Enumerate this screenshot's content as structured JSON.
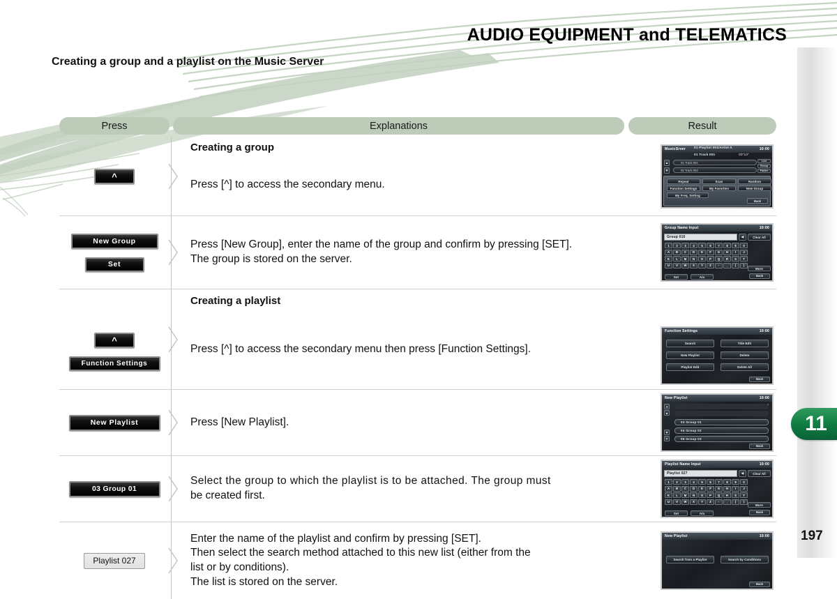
{
  "header": {
    "title": "AUDIO EQUIPMENT and TELEMATICS"
  },
  "subtitle": "Creating a group and a playlist on the Music Server",
  "columns": {
    "press": "Press",
    "explanations": "Explanations",
    "result": "Result"
  },
  "sections": {
    "group": "Creating a group",
    "playlist": "Creating a playlist"
  },
  "chapter_tab": "11",
  "page_number": "197",
  "rows": [
    {
      "keys": [
        {
          "label": "^",
          "style": "kup"
        }
      ],
      "explanation": [
        "Press [^] to access the secondary menu."
      ]
    },
    {
      "keys": [
        {
          "label": "New Group",
          "style": "wide"
        },
        {
          "label": "Set",
          "style": "set"
        }
      ],
      "explanation": [
        "Press [New Group], enter the name of the group and confirm by pressing [SET].",
        "The group is stored on the server."
      ]
    },
    {
      "keys": [
        {
          "label": "^",
          "style": "kup"
        },
        {
          "label": "Function Settings",
          "style": "fn"
        }
      ],
      "explanation": [
        "Press [^] to access the secondary menu then press [Function Settings]."
      ]
    },
    {
      "keys": [
        {
          "label": "New Playlist",
          "style": "newpl"
        }
      ],
      "explanation": [
        "Press [New Playlist]."
      ]
    },
    {
      "keys": [
        {
          "label": "03   Group 01",
          "style": "grp"
        }
      ],
      "explanation": [
        "Select the group to which the playlist is to be attached. The group must",
        "be created first."
      ]
    },
    {
      "keys": [
        {
          "label": "Playlist 027",
          "style": "light"
        }
      ],
      "explanation": [
        "Enter the name of the playlist and confirm by pressing [SET].",
        "Then select the search method attached to this new list (either from the",
        "list or by conditions).",
        "The list is stored on the server."
      ]
    }
  ],
  "screens": {
    "music_server": {
      "title": "MusicSrver",
      "clock": "10:00",
      "meta_line1": "01 Playlist 001/Artist A",
      "meta_line2": "01 Track 001",
      "time_elapsed": "00\"13\"",
      "track_row": "01  Track 001",
      "track_row2": "02  Track 002",
      "side_buttons": [
        "List",
        "Group",
        "Folder"
      ],
      "buttons": [
        "Repeat",
        "Scan",
        "Random",
        "Function Settings",
        "My Favorites",
        "New Group",
        "My Freq. Setting"
      ],
      "back": "Back"
    },
    "group_name_input": {
      "title": "Group Name Input",
      "clock": "10:00",
      "field_value": "Group 010",
      "clear_all": "Clear All",
      "more": "More",
      "set": "Set",
      "case": "A/a",
      "back": "Back",
      "keyrows": [
        [
          "1",
          "2",
          "3",
          "4",
          "5",
          "6",
          "7",
          "8",
          "9",
          "0"
        ],
        [
          "A",
          "B",
          "C",
          "D",
          "E",
          "F",
          "G",
          "H",
          "I",
          "J"
        ],
        [
          "K",
          "L",
          "M",
          "N",
          "O",
          "P",
          "Q",
          "R",
          "S",
          "T"
        ],
        [
          "U",
          "V",
          "W",
          "X",
          "Y",
          "Z",
          "-",
          "_",
          "(",
          ")"
        ]
      ]
    },
    "function_settings": {
      "title": "Function Settings",
      "clock": "10:00",
      "buttons": [
        "Search",
        "Title Edit",
        "New Playlist",
        "Delete",
        "Playlist Edit",
        "Delete All"
      ],
      "back": "Back"
    },
    "new_playlist_list": {
      "title": "New Playlist",
      "clock": "10:00",
      "counter": "3/15",
      "items": [
        "03  Group 01",
        "04  Group 02",
        "05  Group 03"
      ],
      "back": "Back"
    },
    "playlist_name_input": {
      "title": "Playlist Name Input",
      "clock": "10:00",
      "field_value": "Playlist 027",
      "clear_all": "Clear All",
      "more": "More",
      "set": "Set",
      "case": "A/a",
      "back": "Back",
      "keyrows": [
        [
          "1",
          "2",
          "3",
          "4",
          "5",
          "6",
          "7",
          "8",
          "9",
          "0"
        ],
        [
          "A",
          "B",
          "C",
          "D",
          "E",
          "F",
          "G",
          "H",
          "I",
          "J"
        ],
        [
          "K",
          "L",
          "M",
          "N",
          "O",
          "P",
          "Q",
          "R",
          "S",
          "T"
        ],
        [
          "U",
          "V",
          "W",
          "X",
          "Y",
          "Z",
          "-",
          "_",
          "(",
          ")"
        ]
      ]
    },
    "new_playlist_search": {
      "title": "New Playlist",
      "clock": "10:00",
      "buttons": [
        "Search from a Playlist",
        "Search by Conditions"
      ],
      "back": "Back"
    }
  },
  "colors": {
    "accent_green": "#bcccb9",
    "tab_green": "#0e7a41",
    "swoosh": "#c3d2c0"
  }
}
